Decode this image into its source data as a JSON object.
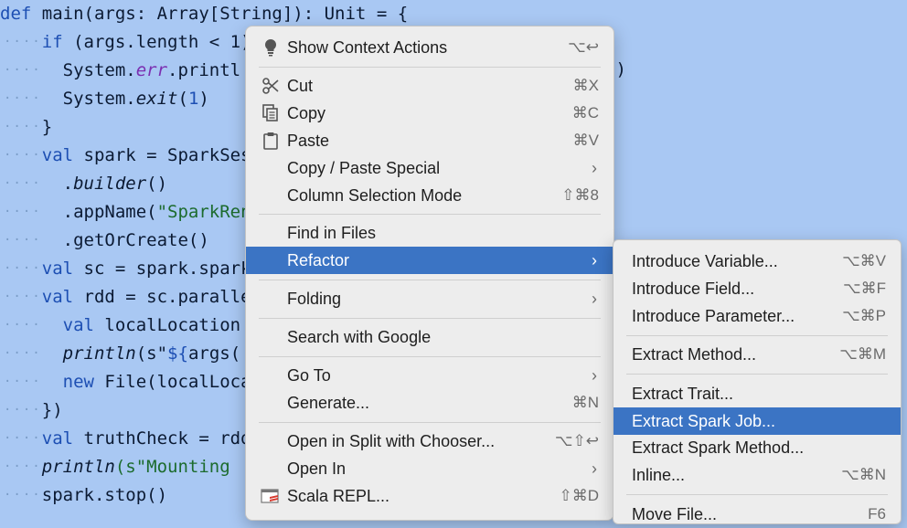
{
  "editor": {
    "lines": [
      {
        "parts": [
          {
            "t": "def ",
            "c": "kw"
          },
          {
            "t": "main(args: Array[String]): Unit = {",
            "c": ""
          }
        ]
      },
      {
        "parts": [
          {
            "t": "    if ",
            "c": "kw"
          },
          {
            "t": "(args.length < 1)",
            "c": ""
          }
        ]
      },
      {
        "parts": [
          {
            "t": "      System.",
            "c": ""
          },
          {
            "t": "err",
            "c": "purple"
          },
          {
            "t": ".printl",
            "c": ""
          }
        ]
      },
      {
        "parts": [
          {
            "t": "      System.",
            "c": ""
          },
          {
            "t": "exit",
            "c": "it"
          },
          {
            "t": "(",
            "c": ""
          },
          {
            "t": "1",
            "c": "num"
          },
          {
            "t": ")",
            "c": ""
          }
        ]
      },
      {
        "parts": [
          {
            "t": "    }",
            "c": ""
          }
        ]
      },
      {
        "parts": [
          {
            "t": "    val ",
            "c": "kw"
          },
          {
            "t": "spark = SparkSes",
            "c": ""
          }
        ]
      },
      {
        "parts": [
          {
            "t": "      .",
            "c": ""
          },
          {
            "t": "builder",
            "c": "it"
          },
          {
            "t": "()",
            "c": ""
          }
        ]
      },
      {
        "parts": [
          {
            "t": "      .appName(",
            "c": ""
          },
          {
            "t": "\"SparkRen",
            "c": "str"
          }
        ]
      },
      {
        "parts": [
          {
            "t": "      .getOrCreate()",
            "c": ""
          }
        ]
      },
      {
        "parts": [
          {
            "t": "    val ",
            "c": "kw"
          },
          {
            "t": "sc = spark.spark",
            "c": ""
          }
        ]
      },
      {
        "parts": [
          {
            "t": "    val ",
            "c": "kw"
          },
          {
            "t": "rdd = sc.paralle",
            "c": ""
          }
        ]
      },
      {
        "parts": [
          {
            "t": "      val ",
            "c": "kw"
          },
          {
            "t": "localLocation",
            "c": ""
          }
        ]
      },
      {
        "parts": [
          {
            "t": "      ",
            "c": ""
          },
          {
            "t": "println",
            "c": "it"
          },
          {
            "t": "(s\"",
            "c": ""
          },
          {
            "t": "${",
            "c": "kw"
          },
          {
            "t": "args(",
            "c": ""
          }
        ]
      },
      {
        "parts": [
          {
            "t": "      new ",
            "c": "kw"
          },
          {
            "t": "File(localLoca",
            "c": ""
          }
        ]
      },
      {
        "parts": [
          {
            "t": "    })",
            "c": ""
          }
        ]
      },
      {
        "parts": [
          {
            "t": "    val ",
            "c": "kw"
          },
          {
            "t": "truthCheck = rdd",
            "c": ""
          }
        ]
      },
      {
        "parts": [
          {
            "t": "    ",
            "c": ""
          },
          {
            "t": "println",
            "c": "it"
          },
          {
            "t": "(s\"Mounting ",
            "c": "str"
          }
        ]
      },
      {
        "parts": [
          {
            "t": "    spark.stop()",
            "c": ""
          }
        ]
      }
    ],
    "right_fragment": "\")"
  },
  "context_menu": {
    "items": [
      {
        "label": "Show Context Actions",
        "shortcut": "⌥↩",
        "icon": "bulb-icon"
      },
      {
        "sep": true
      },
      {
        "label": "Cut",
        "shortcut": "⌘X",
        "icon": "scissors-icon"
      },
      {
        "label": "Copy",
        "shortcut": "⌘C",
        "icon": "copy-icon"
      },
      {
        "label": "Paste",
        "shortcut": "⌘V",
        "icon": "clipboard-icon"
      },
      {
        "label": "Copy / Paste Special",
        "submenu": true
      },
      {
        "label": "Column Selection Mode",
        "shortcut": "⇧⌘8"
      },
      {
        "sep": true
      },
      {
        "label": "Find in Files"
      },
      {
        "label": "Refactor",
        "submenu": true,
        "selected": true
      },
      {
        "sep": true
      },
      {
        "label": "Folding",
        "submenu": true
      },
      {
        "sep": true
      },
      {
        "label": "Search with Google"
      },
      {
        "sep": true
      },
      {
        "label": "Go To",
        "submenu": true
      },
      {
        "label": "Generate...",
        "shortcut": "⌘N"
      },
      {
        "sep": true
      },
      {
        "label": "Open in Split with Chooser...",
        "shortcut": "⌥⇧↩"
      },
      {
        "label": "Open In",
        "submenu": true
      },
      {
        "label": "Scala REPL...",
        "shortcut": "⇧⌘D",
        "icon": "scala-repl-icon"
      }
    ]
  },
  "refactor_submenu": {
    "items": [
      {
        "label": "Introduce Variable...",
        "shortcut": "⌥⌘V"
      },
      {
        "label": "Introduce Field...",
        "shortcut": "⌥⌘F"
      },
      {
        "label": "Introduce Parameter...",
        "shortcut": "⌥⌘P"
      },
      {
        "sep": true
      },
      {
        "label": "Extract Method...",
        "shortcut": "⌥⌘M"
      },
      {
        "sep": true
      },
      {
        "label": "Extract Trait..."
      },
      {
        "label": "Extract Spark Job...",
        "selected": true
      },
      {
        "label": "Extract Spark Method..."
      },
      {
        "label": "Inline...",
        "shortcut": "⌥⌘N"
      },
      {
        "sep": true
      },
      {
        "label": "Move File...",
        "shortcut": "F6"
      }
    ]
  },
  "colors": {
    "selection": "#3b74c4",
    "editor_bg": "#a9c8f3",
    "menu_bg": "#ededed"
  }
}
